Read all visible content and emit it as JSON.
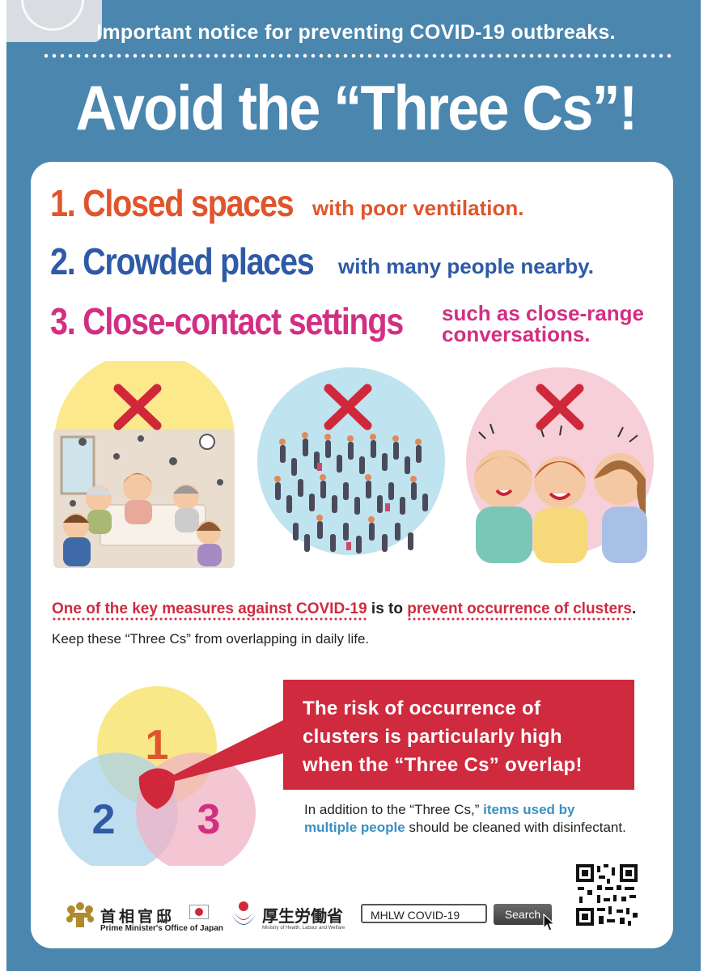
{
  "notice": "Important notice for preventing COVID-19 outbreaks.",
  "headline": "Avoid the “Three Cs”!",
  "items": [
    {
      "title": "1. Closed spaces",
      "detail": "with poor ventilation."
    },
    {
      "title": "2. Crowded places",
      "detail": "with many people nearby."
    },
    {
      "title": "3. Close-contact settings",
      "detail_line1": "such as close-range",
      "detail_line2": "conversations."
    }
  ],
  "measure": {
    "part1": "One of the key measures against COVID-19",
    "part2": " is to ",
    "part3": "prevent occurrence of clusters",
    "part4": "."
  },
  "keep_text": "Keep these “Three Cs” from overlapping in daily life.",
  "venn": {
    "n1": "1",
    "n2": "2",
    "n3": "3"
  },
  "callout": {
    "line1": "The risk of occurrence of",
    "line2": "clusters is particularly high",
    "line3": "when the “Three Cs” overlap!"
  },
  "addition": {
    "pre": "In addition to the “Three Cs,” ",
    "highlight": "items used by multiple people",
    "post": " should be cleaned with disinfectant."
  },
  "footer": {
    "pm_jp": "首相官邸",
    "pm_en": "Prime Minister's Office of Japan",
    "mhlw_jp": "厚生労働省",
    "mhlw_en": "Ministry of Health, Labour and Welfare",
    "search_value": "MHLW COVID-19",
    "search_button": "Search"
  },
  "colors": {
    "background": "#4a86ae",
    "closed": "#e0552b",
    "crowded": "#2e5aa6",
    "contact": "#d22f82",
    "alert_red": "#d02a3e"
  },
  "icons": [
    "x-mark-icon",
    "cursor-icon",
    "qr-code-icon",
    "pm-office-emblem-icon",
    "mhlw-logo-icon"
  ]
}
